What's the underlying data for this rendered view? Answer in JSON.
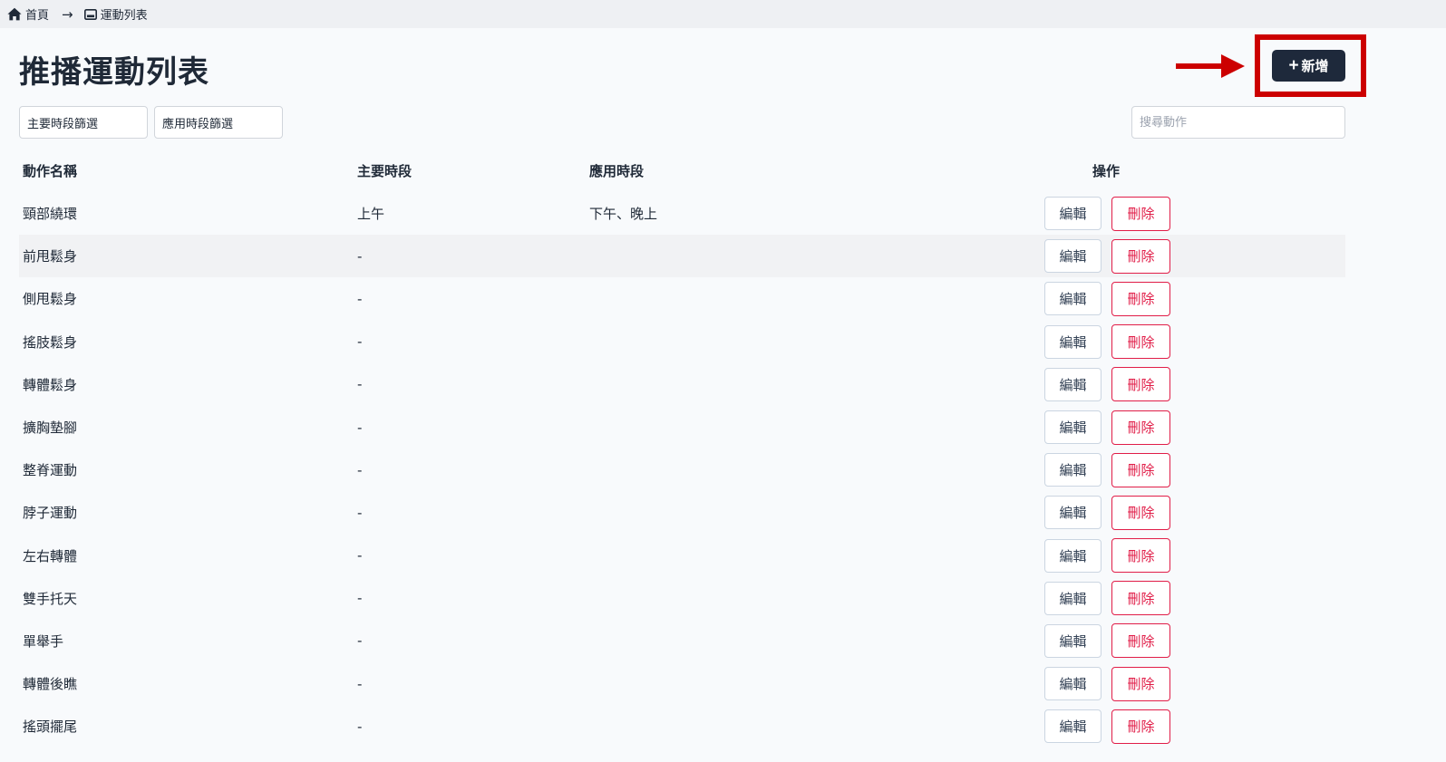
{
  "breadcrumb": {
    "home_label": "首頁",
    "separator": "→",
    "current_label": "運動列表"
  },
  "page_title": "推播運動列表",
  "add_button": {
    "icon": "+",
    "label": "新增"
  },
  "filters": {
    "main_period": "主要時段篩選",
    "applied_period": "應用時段篩選"
  },
  "search": {
    "placeholder": "搜尋動作",
    "value": ""
  },
  "table": {
    "headers": {
      "name": "動作名稱",
      "main_period": "主要時段",
      "applied_period": "應用時段",
      "actions": "操作"
    },
    "edit_label": "編輯",
    "delete_label": "刪除",
    "rows": [
      {
        "name": "頸部繞環",
        "main_period": "上午",
        "applied_period": "下午、晚上"
      },
      {
        "name": "前甩鬆身",
        "main_period": "-",
        "applied_period": ""
      },
      {
        "name": "側甩鬆身",
        "main_period": "-",
        "applied_period": ""
      },
      {
        "name": "搖肢鬆身",
        "main_period": "-",
        "applied_period": ""
      },
      {
        "name": "轉體鬆身",
        "main_period": "-",
        "applied_period": ""
      },
      {
        "name": "擴胸墊腳",
        "main_period": "-",
        "applied_period": ""
      },
      {
        "name": "整脊運動",
        "main_period": "-",
        "applied_period": ""
      },
      {
        "name": "脖子運動",
        "main_period": "-",
        "applied_period": ""
      },
      {
        "name": "左右轉體",
        "main_period": "-",
        "applied_period": ""
      },
      {
        "name": "雙手托天",
        "main_period": "-",
        "applied_period": ""
      },
      {
        "name": "單舉手",
        "main_period": "-",
        "applied_period": ""
      },
      {
        "name": "轉體後瞧",
        "main_period": "-",
        "applied_period": ""
      },
      {
        "name": "搖頭擺尾",
        "main_period": "-",
        "applied_period": ""
      }
    ]
  },
  "colors": {
    "primary_button": "#1e293b",
    "danger": "#e11d48",
    "annotation_red": "#cc0000"
  }
}
